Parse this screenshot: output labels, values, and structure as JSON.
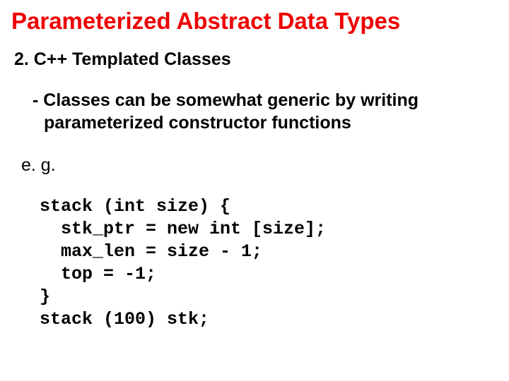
{
  "title": "Parameterized Abstract Data Types",
  "section": "2. C++ Templated Classes",
  "bullet": "- Classes can be somewhat generic by writing parameterized constructor functions",
  "eg": "e. g.",
  "code": "stack (int size) {\n  stk_ptr = new int [size];\n  max_len = size - 1;\n  top = -1;\n}\nstack (100) stk;"
}
